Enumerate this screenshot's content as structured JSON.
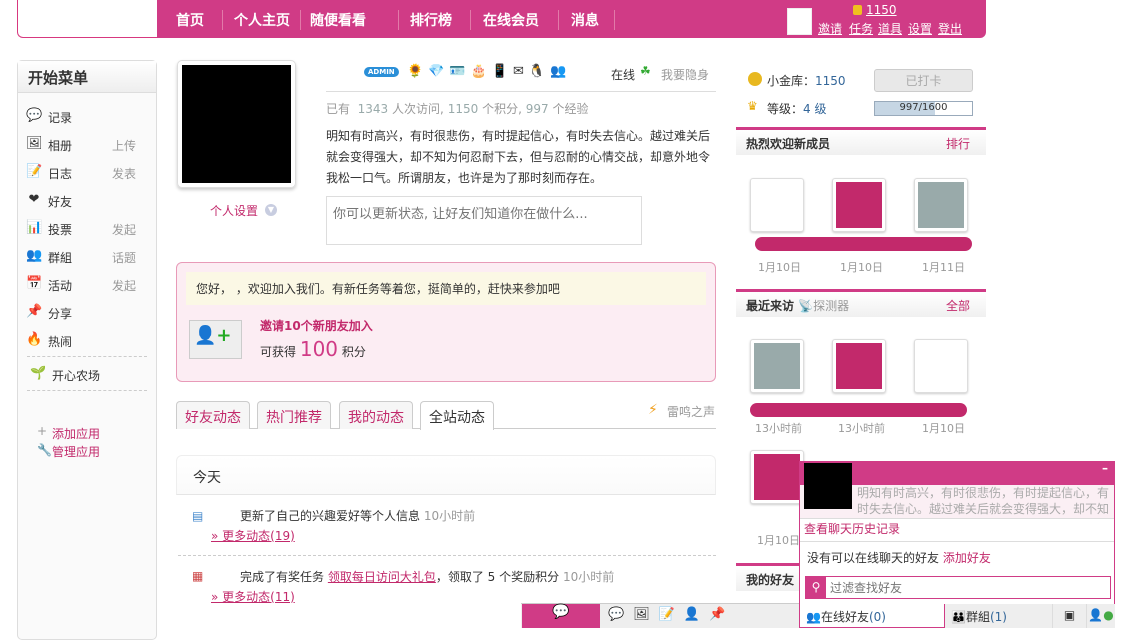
{
  "nav": {
    "items": [
      "首页",
      "个人主页",
      "随便看看",
      "排行榜",
      "在线会员",
      "消息"
    ],
    "coins": "1150",
    "links": [
      "邀请",
      "任务",
      "道具",
      "设置",
      "登出"
    ]
  },
  "sidebar": {
    "title": "开始菜单",
    "items": [
      {
        "label": "记录",
        "extra": "",
        "icon": "💬"
      },
      {
        "label": "相册",
        "extra": "上传",
        "icon": "🖼"
      },
      {
        "label": "日志",
        "extra": "发表",
        "icon": "📝"
      },
      {
        "label": "好友",
        "extra": "",
        "icon": "❤"
      },
      {
        "label": "投票",
        "extra": "发起",
        "icon": "📊"
      },
      {
        "label": "群組",
        "extra": "话题",
        "icon": "👥"
      },
      {
        "label": "活动",
        "extra": "发起",
        "icon": "📅"
      },
      {
        "label": "分享",
        "extra": "",
        "icon": "📌"
      },
      {
        "label": "热闹",
        "extra": "",
        "icon": "🔥"
      }
    ],
    "farm": "开心农场",
    "add_app": "添加应用",
    "manage_app": "管理应用"
  },
  "profile": {
    "settings": "个人设置",
    "admin_badge": "ADMIN",
    "online": "在线",
    "hide": "我要隐身",
    "stats": {
      "prefix": "已有",
      "visits": "1343",
      "visits_label": "人次访问,",
      "points": "1150",
      "points_label": "个积分,",
      "exp": "997",
      "exp_label": "个经验"
    },
    "bio": "明知有时高兴，有时很悲伤，有时提起信心，有时失去信心。越过难关后就会变得强大，却不知为何忍耐下去，但与忍耐的心情交战，却意外地令我松一口气。所谓朋友，也许是为了那时刻而存在。",
    "status_placeholder": "你可以更新状态, 让好友们知道你在做什么..."
  },
  "task": {
    "welcome": "您好，      ，欢迎加入我们。有新任务等着您，挺简单的，赶快来参加吧",
    "title": "邀请10个新朋友加入",
    "reward_prefix": "可获得",
    "reward": "100",
    "reward_suffix": "积分"
  },
  "tabs": [
    "好友动态",
    "热门推荐",
    "我的动态",
    "全站动态"
  ],
  "thunder": "雷鸣之声",
  "feed": {
    "day": "今天",
    "items": [
      {
        "text": "更新了自己的兴趣爱好等个人信息",
        "link": "",
        "after": "",
        "time": "10小时前",
        "more": "» 更多动态(19)"
      },
      {
        "text": "完成了有奖任务",
        "link": "领取每日访问大礼包",
        "after": "，领取了 5 个奖励积分",
        "time": "10小时前",
        "more": "» 更多动态(11)"
      }
    ]
  },
  "right": {
    "gold_label": "小金库：",
    "gold": "1150",
    "checked_in": "已打卡",
    "level_label": "等级：",
    "level": "4 级",
    "progress_text": "997/1600",
    "progress": 0.623,
    "new_members": {
      "title": "热烈欢迎新成员",
      "link": "排行",
      "dates": [
        "1月10日",
        "1月10日",
        "1月11日"
      ]
    },
    "visitors": {
      "title": "最近来访",
      "detector": "探测器",
      "link": "全部",
      "dates": [
        "13小时前",
        "13小时前",
        "1月10日"
      ]
    },
    "third_date": "1月10日",
    "friends_title": "我的好友"
  },
  "chat": {
    "bio": "明知有时高兴，有时很悲伤，有时提起信心，有时失去信心。越过难关后就会变得强大，却不知",
    "history": "查看聊天历史记录",
    "no_friends": "没有可以在线聊天的好友",
    "add_friend": "添加好友",
    "filter_placeholder": "过滤查找好友",
    "online_tab": "在线好友",
    "online_count": "(0)",
    "group_tab": "群組",
    "group_count": "(1)"
  },
  "colors": {
    "brand": "#d03b86",
    "link": "#c2296b"
  }
}
